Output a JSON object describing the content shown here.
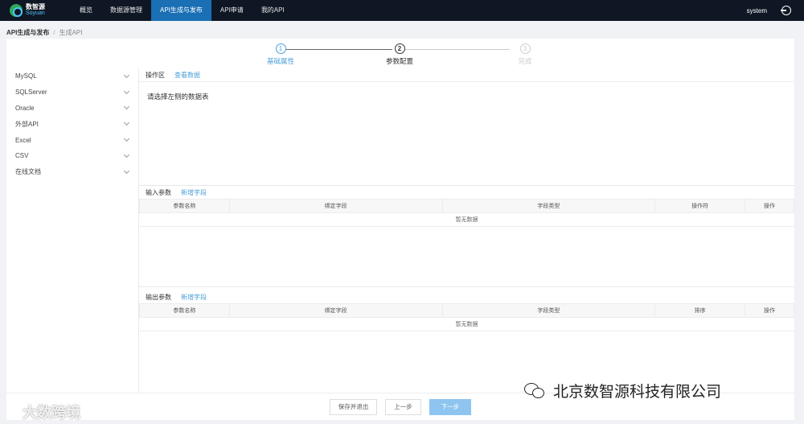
{
  "topbar": {
    "logo_cn": "数智源",
    "logo_en": "Soyuan",
    "nav": [
      "概览",
      "数据源管理",
      "API生成与发布",
      "API申请",
      "我的API"
    ],
    "active_index": 2,
    "user": "system"
  },
  "breadcrumb": {
    "main": "API生成与发布",
    "sep": "/",
    "sub": "生成API"
  },
  "steps": [
    {
      "num": "1",
      "label": "基础属性"
    },
    {
      "num": "2",
      "label": "参数配置"
    },
    {
      "num": "3",
      "label": "完成"
    }
  ],
  "sidebar": {
    "items": [
      "MySQL",
      "SQLServer",
      "Oracle",
      "外部API",
      "Excel",
      "CSV",
      "在线文档"
    ]
  },
  "op_area": {
    "title": "操作区",
    "link": "查看数据",
    "placeholder": "请选择左侧的数据表"
  },
  "input_params": {
    "title": "输入参数",
    "link": "新增字段",
    "columns": [
      "参数名称",
      "绑定字段",
      "字段类型",
      "操作符",
      "操作"
    ],
    "empty": "暂无数据"
  },
  "output_params": {
    "title": "输出参数",
    "link": "新增字段",
    "columns": [
      "参数名称",
      "绑定字段",
      "字段类型",
      "排序",
      "操作"
    ],
    "empty": "暂无数据"
  },
  "footer": {
    "save_exit": "保存并退出",
    "prev": "上一步",
    "next": "下一步"
  },
  "watermarks": {
    "left": "大数跨境",
    "right": "北京数智源科技有限公司"
  },
  "colors": {
    "topbar": "#0f1724",
    "active_nav": "#1a6fb5",
    "link": "#4a9fd8",
    "primary_button": "#8ec5f0"
  }
}
